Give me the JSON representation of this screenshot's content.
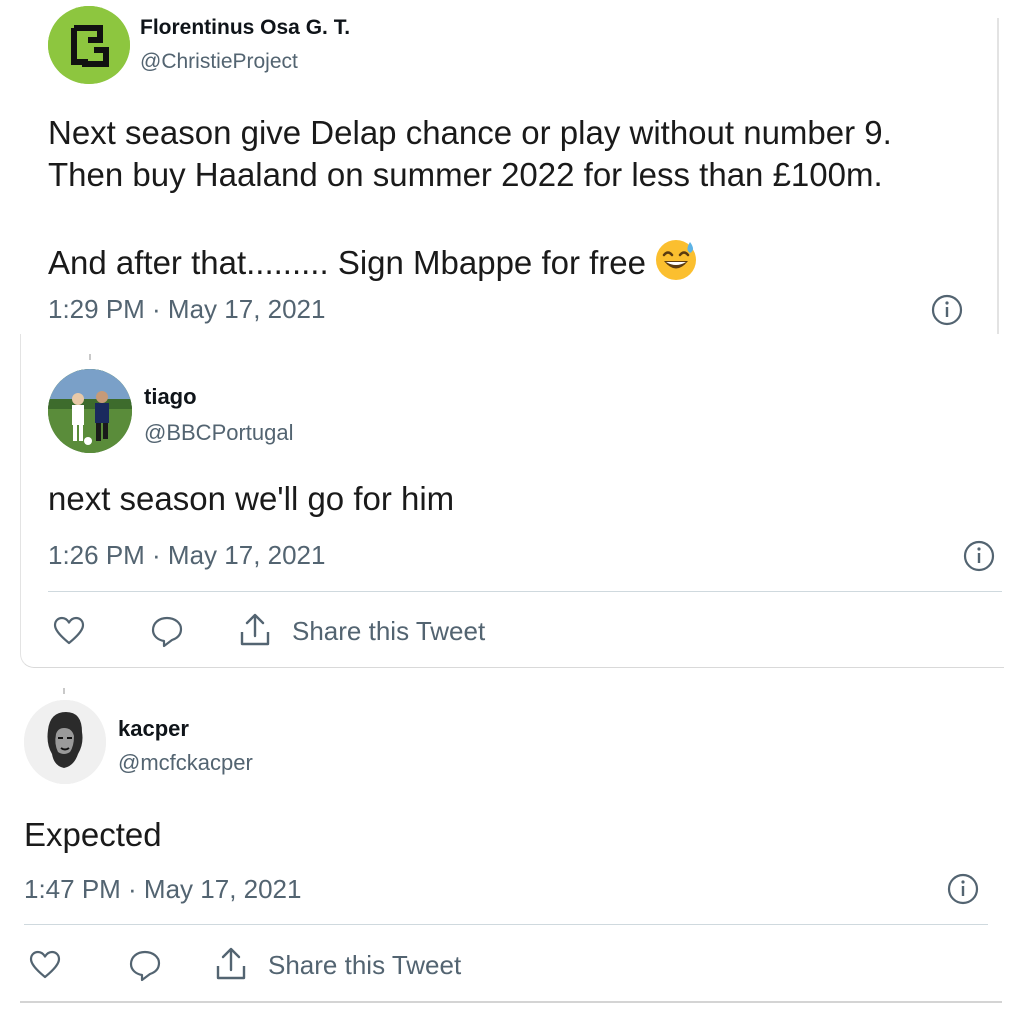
{
  "tweets": [
    {
      "name": "Florentinus Osa G. T.",
      "handle": "@ChristieProject",
      "text": "Next season give Delap chance or play without number 9.\nThen buy Haaland on summer 2022 for less than £100m.\n\nAnd after that......... Sign Mbappe for free",
      "emoji": "grinning-sweat-emoji",
      "time": "1:29 PM · May 17, 2021"
    },
    {
      "name": "tiago",
      "handle": "@BBCPortugal",
      "text": "next season we'll go for him",
      "time": "1:26 PM · May 17, 2021",
      "share_label": "Share this Tweet"
    },
    {
      "name": "kacper",
      "handle": "@mcfckacper",
      "text": "Expected",
      "time": "1:47 PM · May 17, 2021",
      "share_label": "Share this Tweet"
    }
  ],
  "icons": {
    "info": "info-icon",
    "like": "heart-icon",
    "reply": "reply-icon",
    "share": "share-icon"
  },
  "colors": {
    "secondary_text": "#536471",
    "divider": "#cfd9de",
    "avatar_green": "#8dc63f"
  }
}
